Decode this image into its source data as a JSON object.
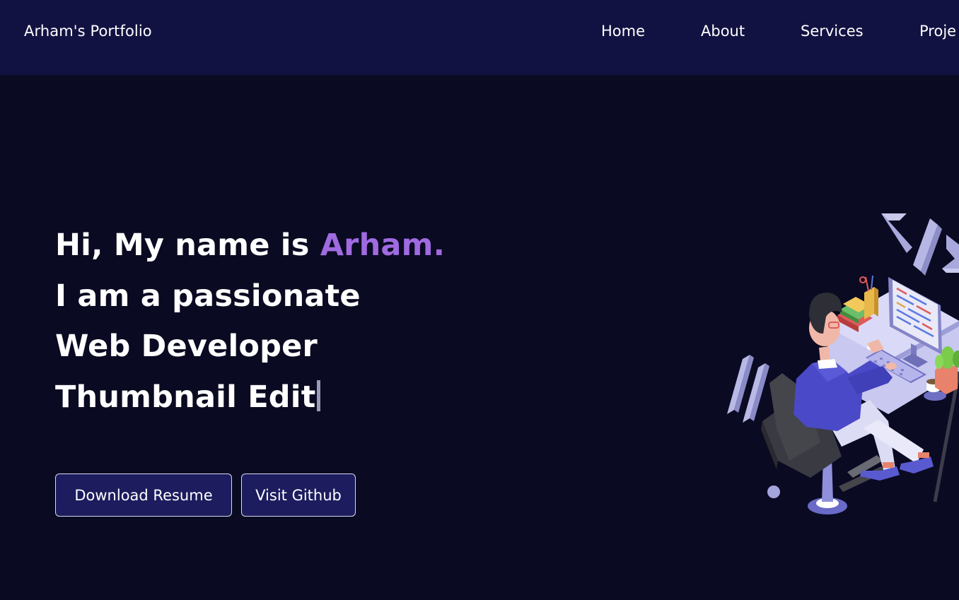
{
  "nav": {
    "brand": "Arham's Portfolio",
    "links": [
      "Home",
      "About",
      "Services",
      "Proje"
    ]
  },
  "hero": {
    "greeting_prefix": "Hi, My name is ",
    "name": "Arham.",
    "line2": "I am a passionate",
    "line3": "Web Developer",
    "typed_text": "Thumbnail Edit",
    "buttons": {
      "resume": "Download Resume",
      "github": "Visit Github"
    }
  },
  "colors": {
    "navbar_bg": "#121242",
    "page_bg": "#0a0a22",
    "accent": "#a06ae0",
    "button_bg": "#1c1c5e"
  },
  "icons": [
    "code-brackets-icon",
    "developer-at-desk-illustration"
  ]
}
